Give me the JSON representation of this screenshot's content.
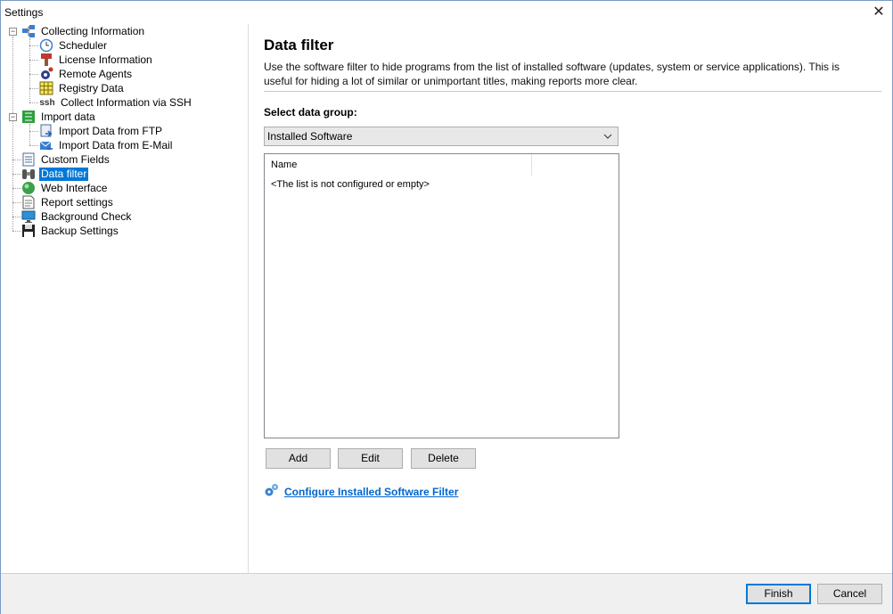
{
  "window": {
    "title": "Settings",
    "close_glyph": "✕"
  },
  "tree": {
    "items": [
      {
        "label": "Collecting Information",
        "icon": "network-icon"
      },
      {
        "label": "Scheduler",
        "icon": "clock-icon"
      },
      {
        "label": "License Information",
        "icon": "license-icon"
      },
      {
        "label": "Remote Agents",
        "icon": "gear-icon"
      },
      {
        "label": "Registry Data",
        "icon": "grid-icon"
      },
      {
        "label": "Collect Information via SSH",
        "icon": "ssh-icon",
        "icon_text": "ssh"
      },
      {
        "label": "Import data",
        "icon": "import-icon"
      },
      {
        "label": "Import Data from FTP",
        "icon": "ftp-icon"
      },
      {
        "label": "Import Data from E-Mail",
        "icon": "email-icon"
      },
      {
        "label": "Custom Fields",
        "icon": "list-icon"
      },
      {
        "label": "Data filter",
        "icon": "filter-icon",
        "selected": true
      },
      {
        "label": "Web Interface",
        "icon": "globe-icon"
      },
      {
        "label": "Report settings",
        "icon": "report-icon"
      },
      {
        "label": "Background Check",
        "icon": "monitor-icon"
      },
      {
        "label": "Backup Settings",
        "icon": "floppy-icon"
      }
    ]
  },
  "main": {
    "title": "Data filter",
    "description": "Use the software filter to hide programs from the list of installed software (updates, system or service applications). This is useful for hiding a lot of similar or unimportant titles, making reports more clear.",
    "group_label": "Select data group:",
    "group_select": {
      "value": "Installed Software"
    },
    "list": {
      "column_name": "Name",
      "empty_text": "<The list is not configured or empty>"
    },
    "buttons": {
      "add": "Add",
      "edit": "Edit",
      "delete": "Delete"
    },
    "configure_link": "Configure Installed Software Filter"
  },
  "footer": {
    "finish": "Finish",
    "cancel": "Cancel"
  },
  "colors": {
    "accent": "#0078d7",
    "link": "#0066cc",
    "footer_bg": "#f0f0f0"
  }
}
